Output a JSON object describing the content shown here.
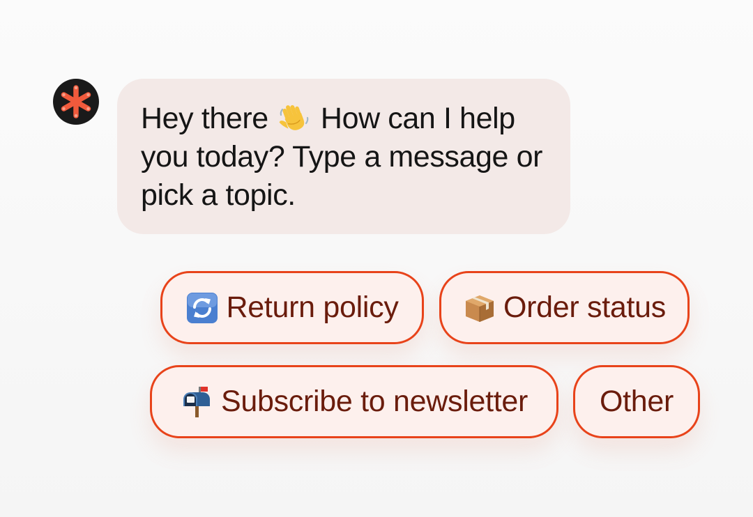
{
  "chat": {
    "bot_avatar_icon": "asterisk-logo-icon",
    "greeting": {
      "before_emoji": "Hey there",
      "emoji": "waving-hand-icon",
      "after_emoji": "How can I help you today? Type a message or pick a topic."
    },
    "quick_replies": [
      {
        "icon": "counterclockwise-arrows-icon",
        "label": "Return policy"
      },
      {
        "icon": "package-icon",
        "label": "Order status"
      },
      {
        "icon": "mailbox-icon",
        "label": "Subscribe to newsletter"
      },
      {
        "icon": "",
        "label": "Other"
      }
    ]
  },
  "colors": {
    "accent": "#e8431a",
    "chip_text": "#6a1c0c",
    "chip_background": "#fdf0ed",
    "bubble_background": "#f3e9e7",
    "avatar_background": "#1a1a1a"
  }
}
